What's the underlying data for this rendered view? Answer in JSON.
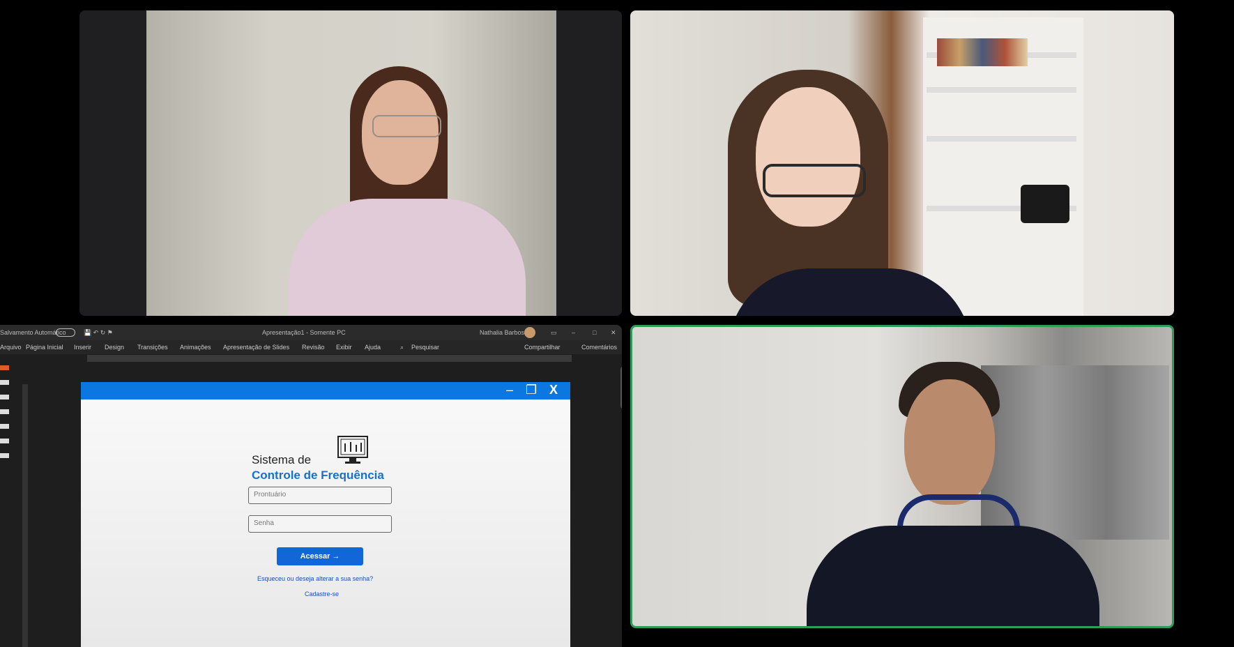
{
  "screen_share": {
    "title_left": "Salvamento Automático",
    "title_center": "Apresentação1 - Somente PC",
    "title_user": "Nathalia Barbosa",
    "menu": [
      "Arquivo",
      "Página Inicial",
      "Inserir",
      "Design",
      "Transições",
      "Animações",
      "Apresentação de Slides",
      "Revisão",
      "Exibir",
      "Ajuda"
    ],
    "search": "Pesquisar",
    "share_btn": "Compartilhar",
    "comments_btn": "Comentários",
    "app": {
      "title_line1": "Sistema de",
      "title_line2": "Controle de Frequência",
      "prontuario_placeholder": "Prontuário",
      "senha_placeholder": "Senha",
      "acessar_label": "Acessar →",
      "forgot_link": "Esqueceu ou deseja alterar a sua senha?",
      "signup_link": "Cadastre-se"
    }
  },
  "colors": {
    "active_speaker_border": "#2f9a5a",
    "app_bar": "#0a78e0",
    "brand_blue": "#1670cc",
    "button_blue": "#1267d8"
  },
  "icons": {
    "window_controls": [
      "minimize-icon",
      "maximize-icon",
      "close-icon"
    ],
    "logo": "monitor-icon"
  }
}
